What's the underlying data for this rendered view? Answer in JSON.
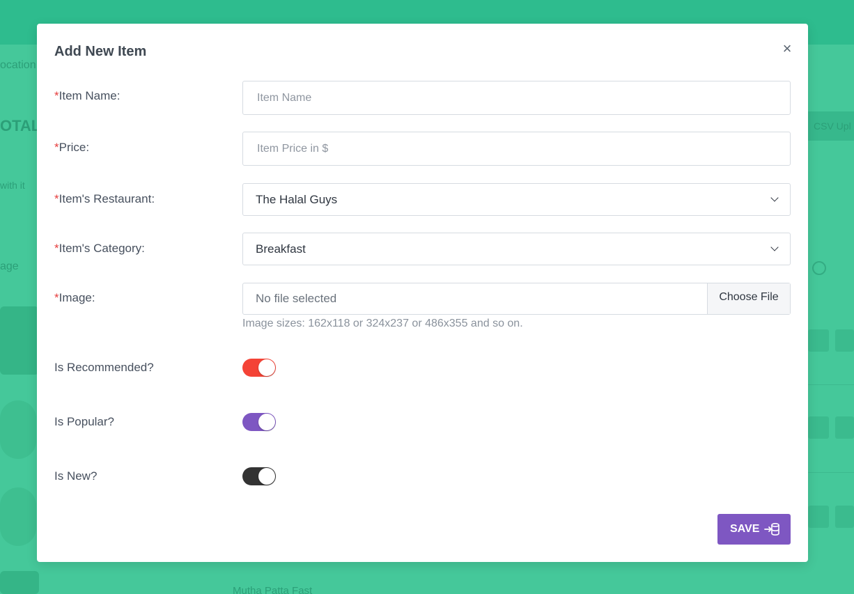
{
  "background": {
    "breadcrumb_fragment": "ocation",
    "total_fragment": "OTAL",
    "with_fragment": "with it",
    "image_col_fragment": "age",
    "csv_button_fragment": "CSV Upl",
    "row_title_fragment": "Mutha Patta Fast"
  },
  "modal": {
    "title": "Add New Item",
    "close_label": "×",
    "fields": {
      "item_name": {
        "required_mark": "*",
        "label": "Item Name:",
        "placeholder": "Item Name",
        "value": ""
      },
      "price": {
        "required_mark": "*",
        "label": "Price:",
        "placeholder": "Item Price in $",
        "value": ""
      },
      "restaurant": {
        "required_mark": "*",
        "label": "Item's Restaurant:",
        "selected": "The Halal Guys"
      },
      "category": {
        "required_mark": "*",
        "label": "Item's Category:",
        "selected": "Breakfast"
      },
      "image": {
        "required_mark": "*",
        "label": "Image:",
        "file_status": "No file selected",
        "button_label": "Choose File",
        "help": "Image sizes: 162x118 or 324x237 or 486x355 and so on."
      }
    },
    "toggles": [
      {
        "label": "Is Recommended?",
        "on": true,
        "color": "#f44336"
      },
      {
        "label": "Is Popular?",
        "on": true,
        "color": "#7e57c2"
      },
      {
        "label": "Is New?",
        "on": true,
        "color": "#333333"
      }
    ],
    "save_label": "SAVE",
    "colors": {
      "required": "#e53e3e",
      "primary": "#7e57c2",
      "backdrop": "#45c89a"
    }
  }
}
